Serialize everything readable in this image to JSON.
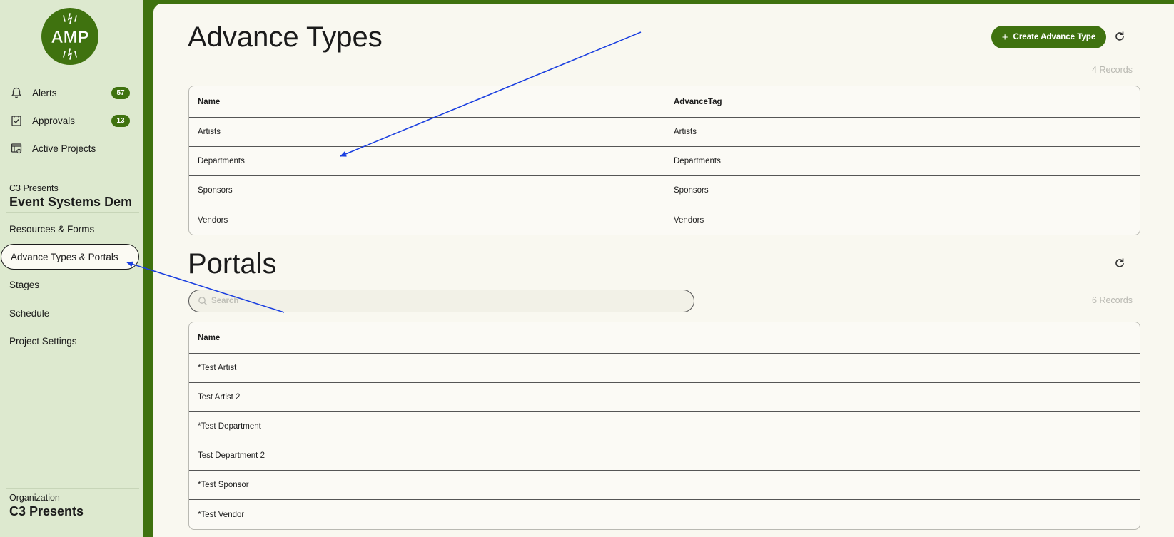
{
  "sidebar": {
    "logo_text": "AMP",
    "nav": [
      {
        "label": "Alerts",
        "badge": "57",
        "icon": "bell-icon"
      },
      {
        "label": "Approvals",
        "badge": "13",
        "icon": "checklist-icon"
      },
      {
        "label": "Active Projects",
        "icon": "projects-icon"
      }
    ],
    "project": {
      "org": "C3 Presents",
      "name": "Event Systems Demo"
    },
    "menu": [
      {
        "label": "Resources & Forms",
        "active": false
      },
      {
        "label": "Advance Types & Portals",
        "active": true
      },
      {
        "label": "Stages",
        "active": false
      },
      {
        "label": "Schedule",
        "active": false
      },
      {
        "label": "Project Settings",
        "active": false
      }
    ],
    "organization": {
      "label": "Organization",
      "name": "C3 Presents"
    }
  },
  "advance_types": {
    "title": "Advance Types",
    "create_label": "Create Advance Type",
    "records": "4 Records",
    "columns": [
      "Name",
      "AdvanceTag"
    ],
    "rows": [
      [
        "Artists",
        "Artists"
      ],
      [
        "Departments",
        "Departments"
      ],
      [
        "Sponsors",
        "Sponsors"
      ],
      [
        "Vendors",
        "Vendors"
      ]
    ]
  },
  "portals": {
    "title": "Portals",
    "search_placeholder": "Search",
    "records": "6 Records",
    "columns": [
      "Name"
    ],
    "rows": [
      "*Test Artist",
      "Test Artist 2",
      "*Test Department",
      "Test Department 2",
      "*Test Sponsor",
      "*Test Vendor"
    ]
  },
  "colors": {
    "brand": "#3f720f",
    "sidebar_bg": "#dde9cf",
    "panel_bg": "#f9f8f0",
    "annotation": "#1a3fe0"
  }
}
